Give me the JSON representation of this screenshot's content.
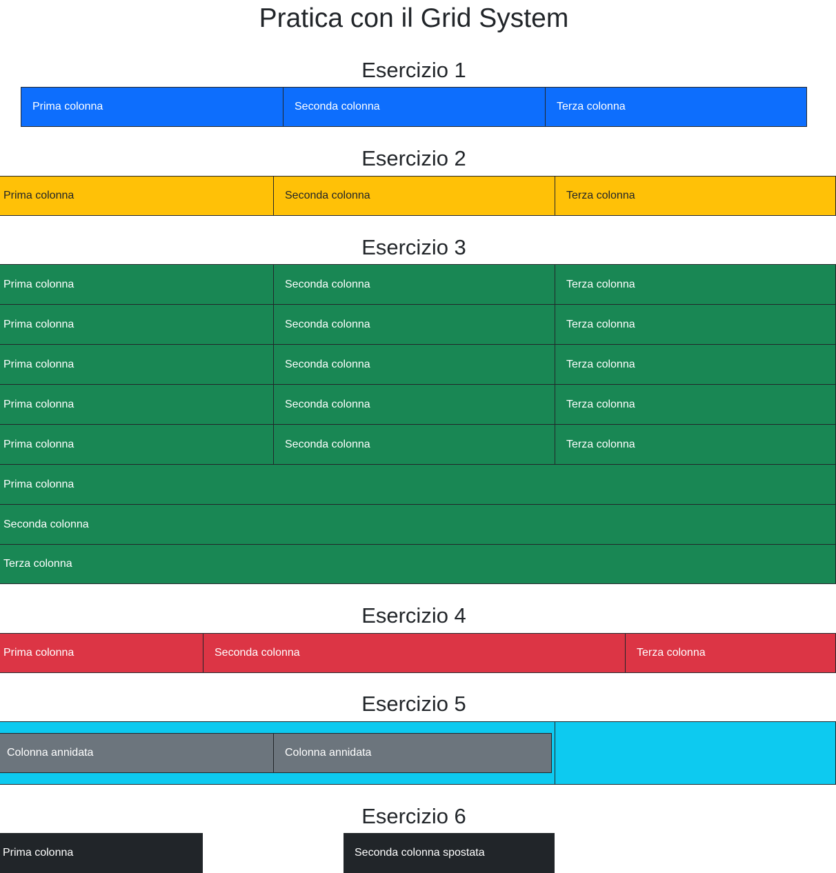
{
  "page": {
    "title": "Pratica con il Grid System"
  },
  "colors": {
    "primary": "#0d6efd",
    "warning": "#ffc107",
    "success": "#198754",
    "danger": "#dc3545",
    "info": "#0dcaf0",
    "secondary": "#6c757d",
    "dark": "#212529"
  },
  "ex1": {
    "heading": "Esercizio 1",
    "cols": [
      "Prima colonna",
      "Seconda colonna",
      "Terza colonna"
    ]
  },
  "ex2": {
    "heading": "Esercizio 2",
    "cols": [
      "Prima colonna",
      "Seconda colonna",
      "Terza colonna"
    ]
  },
  "ex3": {
    "heading": "Esercizio 3",
    "grid_rows": [
      [
        "Prima colonna",
        "Seconda colonna",
        "Terza colonna"
      ],
      [
        "Prima colonna",
        "Seconda colonna",
        "Terza colonna"
      ],
      [
        "Prima colonna",
        "Seconda colonna",
        "Terza colonna"
      ],
      [
        "Prima colonna",
        "Seconda colonna",
        "Terza colonna"
      ],
      [
        "Prima colonna",
        "Seconda colonna",
        "Terza colonna"
      ]
    ],
    "stacked": [
      "Prima colonna",
      "Seconda colonna",
      "Terza colonna"
    ]
  },
  "ex4": {
    "heading": "Esercizio 4",
    "cols": [
      "Prima colonna",
      "Seconda colonna",
      "Terza colonna"
    ]
  },
  "ex5": {
    "heading": "Esercizio 5",
    "nested": [
      "Colonna annidata",
      "Colonna annidata"
    ]
  },
  "ex6": {
    "heading": "Esercizio 6",
    "cols": [
      "Prima colonna",
      "Seconda colonna spostata"
    ]
  }
}
